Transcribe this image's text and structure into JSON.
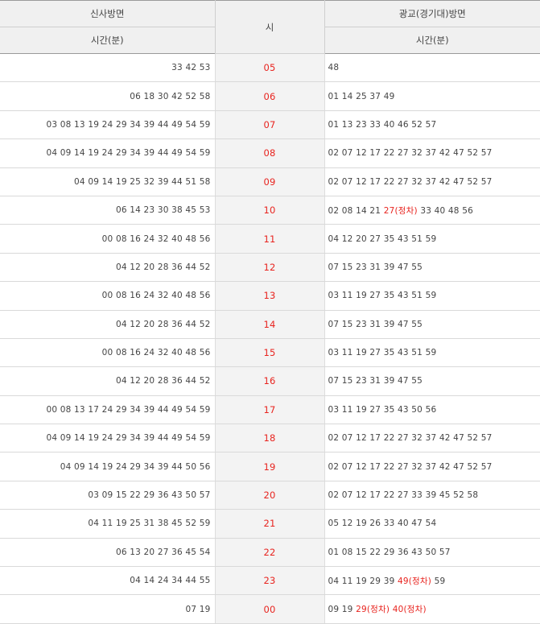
{
  "header": {
    "left_direction": "신사방면",
    "hour_label": "시",
    "right_direction": "광교(경기대)방면",
    "left_minutes_label": "시간(분)",
    "right_minutes_label": "시간(분)"
  },
  "colors": {
    "accent": "#e8241f",
    "header_bg": "#f0f0f0",
    "hour_bg": "#f3f3f3"
  },
  "rows": [
    {
      "hour": "05",
      "left": "33 42 53",
      "right": [
        {
          "t": "48"
        }
      ]
    },
    {
      "hour": "06",
      "left": "06 18 30 42 52 58",
      "right": [
        {
          "t": "01 14 25 37 49"
        }
      ]
    },
    {
      "hour": "07",
      "left": "03 08 13 19 24 29 34 39 44 49 54 59",
      "right": [
        {
          "t": "01 13 23 33 40 46 52 57"
        }
      ]
    },
    {
      "hour": "08",
      "left": "04 09 14 19 24 29 34 39 44 49 54 59",
      "right": [
        {
          "t": "02 07 12 17 22 27 32 37 42 47 52 57"
        }
      ]
    },
    {
      "hour": "09",
      "left": "04 09 14 19 25 32 39 44 51 58",
      "right": [
        {
          "t": "02 07 12 17 22 27 32 37 42 47 52 57"
        }
      ]
    },
    {
      "hour": "10",
      "left": "06 14 23 30 38 45 53",
      "right": [
        {
          "t": "02 08 14 21 "
        },
        {
          "t": "27(정차)",
          "red": true
        },
        {
          "t": " 33 40 48 56"
        }
      ]
    },
    {
      "hour": "11",
      "left": "00 08 16 24 32 40 48 56",
      "right": [
        {
          "t": "04 12 20 27 35 43 51 59"
        }
      ]
    },
    {
      "hour": "12",
      "left": "04 12 20 28 36 44 52",
      "right": [
        {
          "t": "07 15 23 31 39 47 55"
        }
      ]
    },
    {
      "hour": "13",
      "left": "00 08 16 24 32 40 48 56",
      "right": [
        {
          "t": "03 11 19 27 35 43 51 59"
        }
      ]
    },
    {
      "hour": "14",
      "left": "04 12 20 28 36 44 52",
      "right": [
        {
          "t": "07 15 23 31 39 47 55"
        }
      ]
    },
    {
      "hour": "15",
      "left": "00 08 16 24 32 40 48 56",
      "right": [
        {
          "t": "03 11 19 27 35 43 51 59"
        }
      ]
    },
    {
      "hour": "16",
      "left": "04 12 20 28 36 44 52",
      "right": [
        {
          "t": "07 15 23 31 39 47 55"
        }
      ]
    },
    {
      "hour": "17",
      "left": "00 08 13 17 24 29 34 39 44 49 54 59",
      "right": [
        {
          "t": "03 11 19 27 35 43 50 56"
        }
      ]
    },
    {
      "hour": "18",
      "left": "04 09 14 19 24 29 34 39 44 49 54 59",
      "right": [
        {
          "t": "02 07 12 17 22 27 32 37 42 47 52 57"
        }
      ]
    },
    {
      "hour": "19",
      "left": "04 09 14 19 24 29 34 39 44 50 56",
      "right": [
        {
          "t": "02 07 12 17 22 27 32 37 42 47 52 57"
        }
      ]
    },
    {
      "hour": "20",
      "left": "03 09 15 22 29 36 43 50 57",
      "right": [
        {
          "t": "02 07 12 17 22 27 33 39 45 52 58"
        }
      ]
    },
    {
      "hour": "21",
      "left": "04 11 19 25 31 38 45 52 59",
      "right": [
        {
          "t": "05 12 19 26 33 40 47 54"
        }
      ]
    },
    {
      "hour": "22",
      "left": "06 13 20 27 36 45 54",
      "right": [
        {
          "t": "01 08 15 22 29 36 43 50 57"
        }
      ]
    },
    {
      "hour": "23",
      "left": "04 14 24 34 44 55",
      "right": [
        {
          "t": "04 11 19 29 39 "
        },
        {
          "t": "49(정차)",
          "red": true
        },
        {
          "t": " 59"
        }
      ]
    },
    {
      "hour": "00",
      "left": "07 19",
      "right": [
        {
          "t": "09 19 "
        },
        {
          "t": "29(정차) 40(정차)",
          "red": true
        }
      ]
    }
  ]
}
